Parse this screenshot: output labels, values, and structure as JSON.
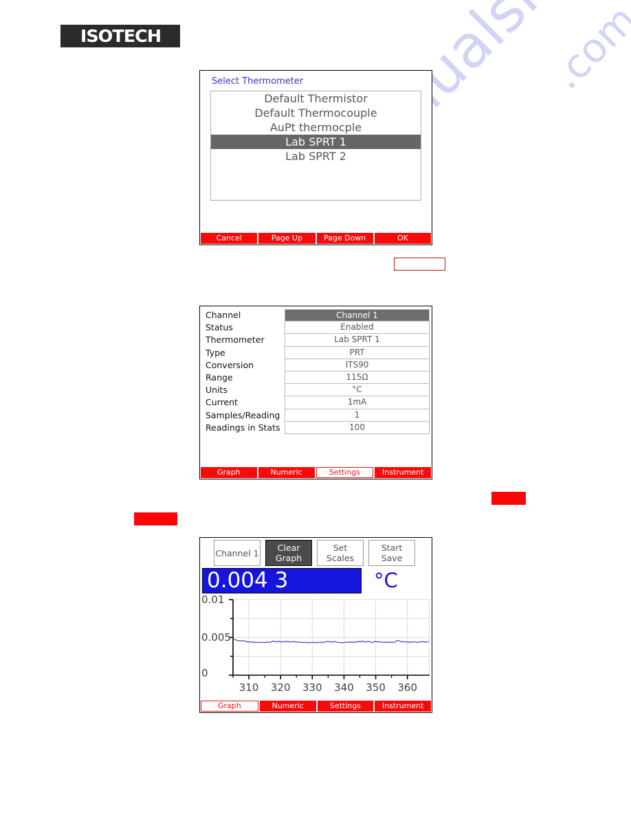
{
  "page": {
    "logo_text": "ISOTECH",
    "watermark_line_1": "manualshive.com",
    "watermark_line_2": ".com"
  },
  "select_thermometer_dialog": {
    "title": "Select Thermometer",
    "items": [
      {
        "label": "Default Thermistor",
        "selected": false
      },
      {
        "label": "Default Thermocouple",
        "selected": false
      },
      {
        "label": "AuPt thermocple",
        "selected": false
      },
      {
        "label": "Lab SPRT 1",
        "selected": true
      },
      {
        "label": "Lab SPRT 2",
        "selected": false
      }
    ],
    "buttons": [
      {
        "label": "Cancel",
        "active": false
      },
      {
        "label": "Page Up",
        "active": false
      },
      {
        "label": "Page Down",
        "active": false
      },
      {
        "label": "OK",
        "active": false
      }
    ]
  },
  "settings_panel": {
    "rows": [
      {
        "label": "Channel",
        "value": "Channel 1"
      },
      {
        "label": "Status",
        "value": "Enabled"
      },
      {
        "label": "Thermometer",
        "value": "Lab SPRT 1"
      },
      {
        "label": "Type",
        "value": "PRT"
      },
      {
        "label": "Conversion",
        "value": "ITS90"
      },
      {
        "label": "Range",
        "value": "115Ω"
      },
      {
        "label": "Units",
        "value": "°C"
      },
      {
        "label": "Current",
        "value": "1mA"
      },
      {
        "label": "Samples/Reading",
        "value": "1"
      },
      {
        "label": "Readings in Stats",
        "value": "100"
      }
    ],
    "tabs": [
      {
        "label": "Graph",
        "active": false
      },
      {
        "label": "Numeric",
        "active": false
      },
      {
        "label": "Settings",
        "active": true
      },
      {
        "label": "Instrument",
        "active": false
      }
    ]
  },
  "graph_panel": {
    "toolbar": [
      {
        "label_line1": "Channel 1",
        "label_line2": "",
        "highlighted": false
      },
      {
        "label_line1": "Clear",
        "label_line2": "Graph",
        "highlighted": true
      },
      {
        "label_line1": "Set",
        "label_line2": "Scales",
        "highlighted": false
      },
      {
        "label_line1": "Start",
        "label_line2": "Save",
        "highlighted": false
      }
    ],
    "reading_value": "0.004 3",
    "reading_units": "°C",
    "tabs": [
      {
        "label": "Graph",
        "active": true
      },
      {
        "label": "Numeric",
        "active": false
      },
      {
        "label": "Settings",
        "active": false
      },
      {
        "label": "Instrument",
        "active": false
      }
    ]
  },
  "chart_data": {
    "type": "line",
    "title": "",
    "xlabel": "",
    "ylabel": "",
    "xlim": [
      305,
      367
    ],
    "ylim": [
      0,
      0.01
    ],
    "grid": true,
    "legend": "none",
    "y_ticks_labeled": [
      "0.01",
      "0.005",
      "0"
    ],
    "y_tick_values": [
      0.01,
      0.005,
      0
    ],
    "y_minor_ticks": [
      0.0075,
      0.0025
    ],
    "x_ticks_labeled": [
      "310",
      "320",
      "330",
      "340",
      "350",
      "360"
    ],
    "x_tick_values": [
      310,
      320,
      330,
      340,
      350,
      360
    ],
    "series": [
      {
        "name": "Channel 1",
        "color": "#4a4ad0",
        "x": [
          305.0,
          305.6,
          306.2,
          306.8,
          307.4,
          308.0,
          308.6,
          309.2,
          309.8,
          310.4,
          311.0,
          311.6,
          312.2,
          312.8,
          313.4,
          314.0,
          314.6,
          315.2,
          315.8,
          316.4,
          317.0,
          317.6,
          318.2,
          318.8,
          319.4,
          320.0,
          320.6,
          321.2,
          321.8,
          322.4,
          323.0,
          323.6,
          324.2,
          324.8,
          325.4,
          326.0,
          326.6,
          327.2,
          327.8,
          328.4,
          329.0,
          329.6,
          330.2,
          330.8,
          331.4,
          332.0,
          332.6,
          333.2,
          333.8,
          334.4,
          335.0,
          335.6,
          336.2,
          336.8,
          337.4,
          338.0,
          338.6,
          339.2,
          339.8,
          340.4,
          341.0,
          341.6,
          342.2,
          342.8,
          343.4,
          344.0,
          344.6,
          345.2,
          345.8,
          346.4,
          347.0,
          347.6,
          348.2,
          348.8,
          349.4,
          350.0,
          350.6,
          351.2,
          351.8,
          352.4,
          353.0,
          353.6,
          354.2,
          354.8,
          355.4,
          356.0,
          356.6,
          357.2,
          357.8,
          358.4,
          359.0,
          359.6,
          360.2,
          360.8,
          361.4,
          362.0,
          362.6,
          363.2,
          363.8,
          364.4,
          365.0,
          365.6,
          366.2,
          366.8
        ],
        "y": [
          0.00478,
          0.0047,
          0.00462,
          0.00455,
          0.00452,
          0.00458,
          0.00452,
          0.00445,
          0.00442,
          0.0044,
          0.00438,
          0.00436,
          0.00434,
          0.00433,
          0.00435,
          0.00433,
          0.00432,
          0.00434,
          0.00436,
          0.00434,
          0.00438,
          0.00452,
          0.00446,
          0.0044,
          0.0045,
          0.00444,
          0.00438,
          0.00448,
          0.00442,
          0.00446,
          0.0044,
          0.00442,
          0.00444,
          0.0044,
          0.00438,
          0.00436,
          0.00434,
          0.00432,
          0.00434,
          0.00432,
          0.0043,
          0.00432,
          0.00434,
          0.00432,
          0.0043,
          0.00434,
          0.00436,
          0.00432,
          0.00438,
          0.00444,
          0.00448,
          0.00442,
          0.00436,
          0.00446,
          0.0044,
          0.00436,
          0.00432,
          0.0043,
          0.00432,
          0.00434,
          0.00436,
          0.00438,
          0.0044,
          0.00438,
          0.00436,
          0.0044,
          0.0045,
          0.00442,
          0.00452,
          0.00444,
          0.00438,
          0.0045,
          0.00442,
          0.0043,
          0.00444,
          0.00448,
          0.00442,
          0.00438,
          0.0044,
          0.00436,
          0.00434,
          0.00436,
          0.00438,
          0.00436,
          0.00434,
          0.00436,
          0.00455,
          0.0046,
          0.00448,
          0.0044,
          0.00444,
          0.0044,
          0.00436,
          0.00438,
          0.0044,
          0.00442,
          0.00438,
          0.00436,
          0.0044,
          0.00444,
          0.00442,
          0.00438,
          0.0044,
          0.00442
        ]
      }
    ]
  },
  "annotations": {
    "redaction_outline": {
      "label": ""
    },
    "redaction_blocks": [
      {
        "label": ""
      },
      {
        "label": ""
      }
    ]
  }
}
